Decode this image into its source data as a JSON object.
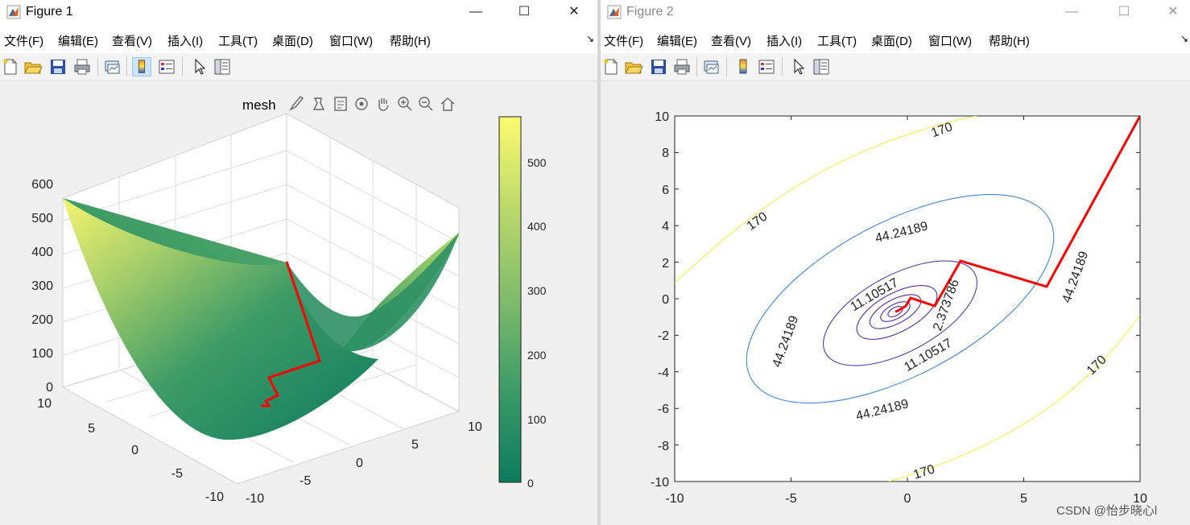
{
  "figure1": {
    "title": "Figure 1",
    "controls": {
      "minimize": "—",
      "maximize": "☐",
      "close": "✕"
    },
    "menu": [
      "文件(F)",
      "编辑(E)",
      "查看(V)",
      "插入(I)",
      "工具(T)",
      "桌面(D)",
      "窗口(W)",
      "帮助(H)"
    ],
    "dock_glyph": "↘",
    "axes_title": "mesh",
    "z_ticks": [
      "0",
      "100",
      "200",
      "300",
      "400",
      "500",
      "600"
    ],
    "y_ticks": [
      "-10",
      "-5",
      "0",
      "5",
      "10"
    ],
    "x_ticks": [
      "-10",
      "-5",
      "0",
      "5",
      "10"
    ],
    "colorbar_ticks": [
      "0",
      "100",
      "200",
      "300",
      "400",
      "500"
    ],
    "colorbar_colors": [
      "#0d7a5e",
      "#3b9b67",
      "#7fbc6b",
      "#bcd96b",
      "#fbfb6e"
    ],
    "path_color": "#ff0000"
  },
  "figure2": {
    "title": "Figure 2",
    "controls": {
      "minimize": "—",
      "maximize": "☐",
      "close": "✕"
    },
    "menu": [
      "文件(F)",
      "编辑(E)",
      "查看(V)",
      "插入(I)",
      "工具(T)",
      "桌面(D)",
      "窗口(W)",
      "帮助(H)"
    ],
    "dock_glyph": "↘",
    "x_ticks": [
      "-10",
      "-5",
      "0",
      "5",
      "10"
    ],
    "y_ticks": [
      "10",
      "8",
      "6",
      "4",
      "2",
      "0",
      "-2",
      "-4",
      "-6",
      "-8",
      "-10"
    ],
    "contour_labels": {
      "l170a": "170",
      "l170b": "170",
      "l170c": "170",
      "l170d": "170",
      "l44a": "44.24189",
      "l44b": "44.24189",
      "l44c": "44.24189",
      "l44d": "44.24189",
      "l11a": "11.10517",
      "l11b": "11.10517",
      "l2a": "2.373786"
    },
    "contour_colors": {
      "c170": "#f2ef3a",
      "c44": "#2c7be0",
      "c11": "#3a2ea8",
      "inner": "#3e1a9c"
    },
    "path_color": "#ff0000"
  },
  "watermark": "CSDN @怡步晓心l",
  "chart_data": [
    {
      "type": "surface",
      "title": "mesh",
      "z_range": [
        0,
        600
      ],
      "x_range": [
        -10,
        10
      ],
      "y_range": [
        -10,
        10
      ],
      "colorbar_range": [
        0,
        560
      ],
      "description_series": "gradient-descent path (red)"
    },
    {
      "type": "contour",
      "x_range": [
        -10,
        10
      ],
      "y_range": [
        -10,
        10
      ],
      "levels": [
        2.373786,
        11.10517,
        44.24189,
        170
      ],
      "path": {
        "x": [
          10,
          6,
          2.3,
          1.2,
          0.1,
          -0.1,
          -0.5
        ],
        "y": [
          10,
          0.7,
          2.1,
          -0.3,
          0.1,
          -0.4,
          -0.6
        ]
      }
    }
  ]
}
